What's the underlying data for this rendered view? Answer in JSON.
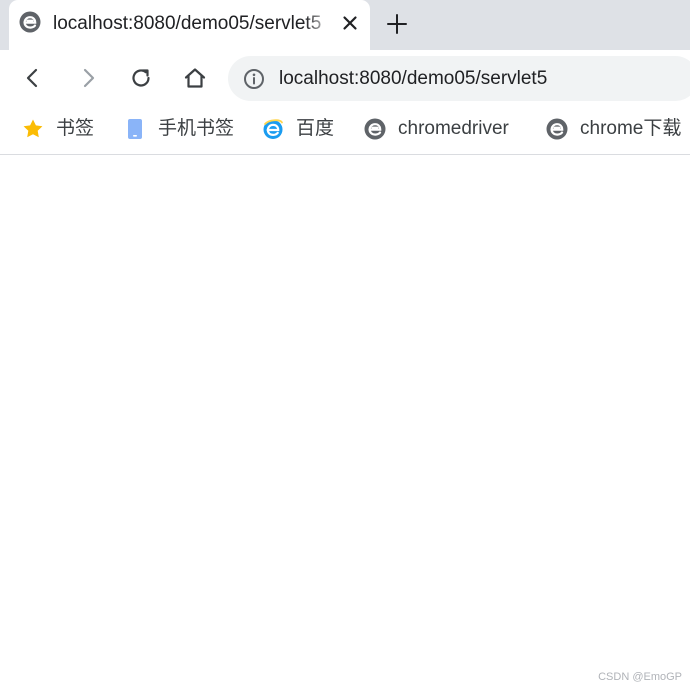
{
  "tab": {
    "title": "localhost:8080/demo05/servlet5",
    "favicon": "edge-e-icon"
  },
  "toolbar": {
    "url": "localhost:8080/demo05/servlet5"
  },
  "bookmarks": [
    {
      "label": "书签",
      "icon": "star-icon"
    },
    {
      "label": "手机书签",
      "icon": "phone-icon"
    },
    {
      "label": "百度",
      "icon": "ie-icon"
    },
    {
      "label": "chromedriver",
      "icon": "edge-e-icon"
    },
    {
      "label": "chrome下载",
      "icon": "edge-e-icon"
    }
  ],
  "watermark": "CSDN @EmoGP",
  "colors": {
    "tabstrip": "#dee1e6",
    "omnibox": "#f1f3f4",
    "star": "#fbbc04",
    "phone": "#8ab4f8"
  }
}
